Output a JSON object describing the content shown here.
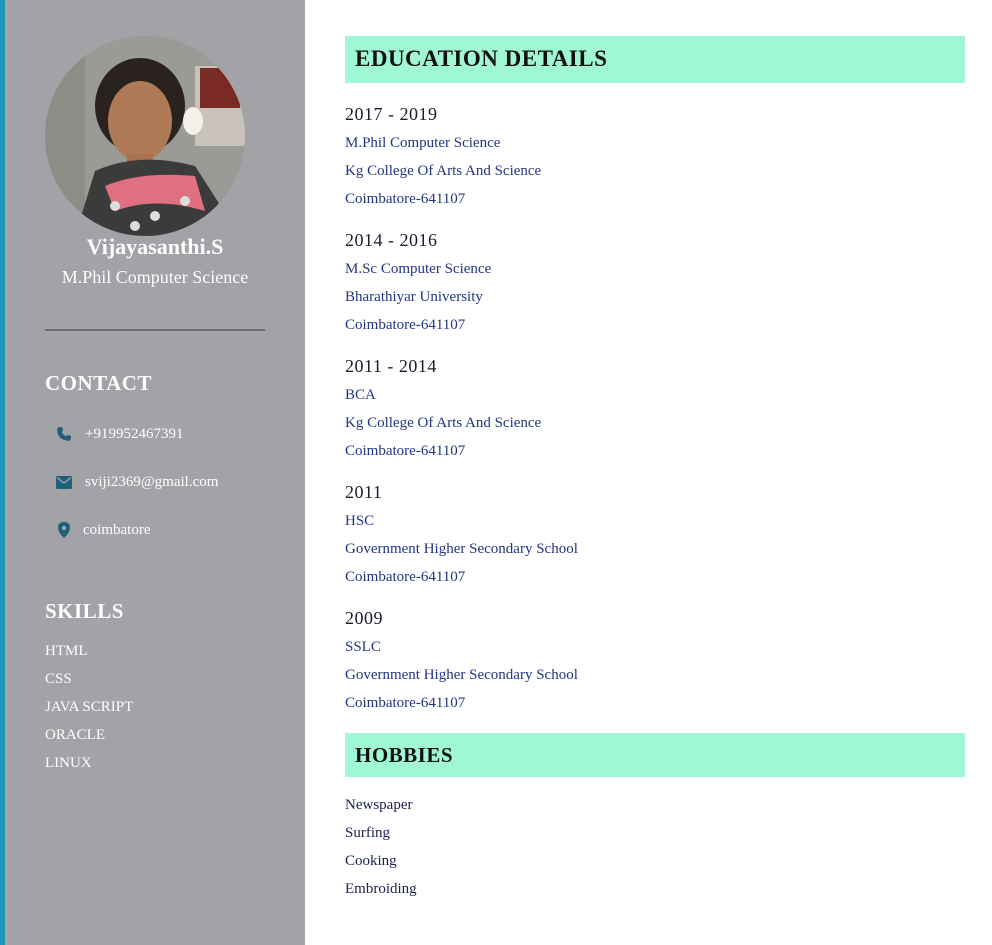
{
  "profile": {
    "name": "Vijayasanthi.S",
    "degree": "M.Phil Computer Science"
  },
  "contact": {
    "heading": "CONTACT",
    "phone": "+919952467391",
    "email": "sviji2369@gmail.com",
    "location": "coimbatore"
  },
  "skills": {
    "heading": "SKILLS",
    "items": [
      "HTML",
      "CSS",
      "JAVA SCRIPT",
      "ORACLE",
      "LINUX"
    ]
  },
  "education": {
    "heading": "EDUCATION DETAILS",
    "entries": [
      {
        "years": "2017 - 2019",
        "course": "M.Phil Computer Science",
        "institution": "Kg College Of Arts And Science",
        "place": "Coimbatore-641107"
      },
      {
        "years": "2014 - 2016",
        "course": "M.Sc Computer Science",
        "institution": "Bharathiyar University",
        "place": "Coimbatore-641107"
      },
      {
        "years": "2011 - 2014",
        "course": "BCA",
        "institution": "Kg College Of Arts And Science",
        "place": "Coimbatore-641107"
      },
      {
        "years": "2011",
        "course": "HSC",
        "institution": "Government Higher Secondary School",
        "place": "Coimbatore-641107"
      },
      {
        "years": "2009",
        "course": "SSLC",
        "institution": "Government Higher Secondary School",
        "place": "Coimbatore-641107"
      }
    ]
  },
  "hobbies": {
    "heading": "HOBBIES",
    "items": [
      "Newspaper",
      "Surfing",
      "Cooking",
      "Embroiding"
    ]
  },
  "colors": {
    "sidebar_bg": "#a3a3a7",
    "accent_strip": "#1f93b8",
    "section_bar": "#9ff7d6",
    "icon_color": "#1e5f7a",
    "link_text": "#203682"
  }
}
